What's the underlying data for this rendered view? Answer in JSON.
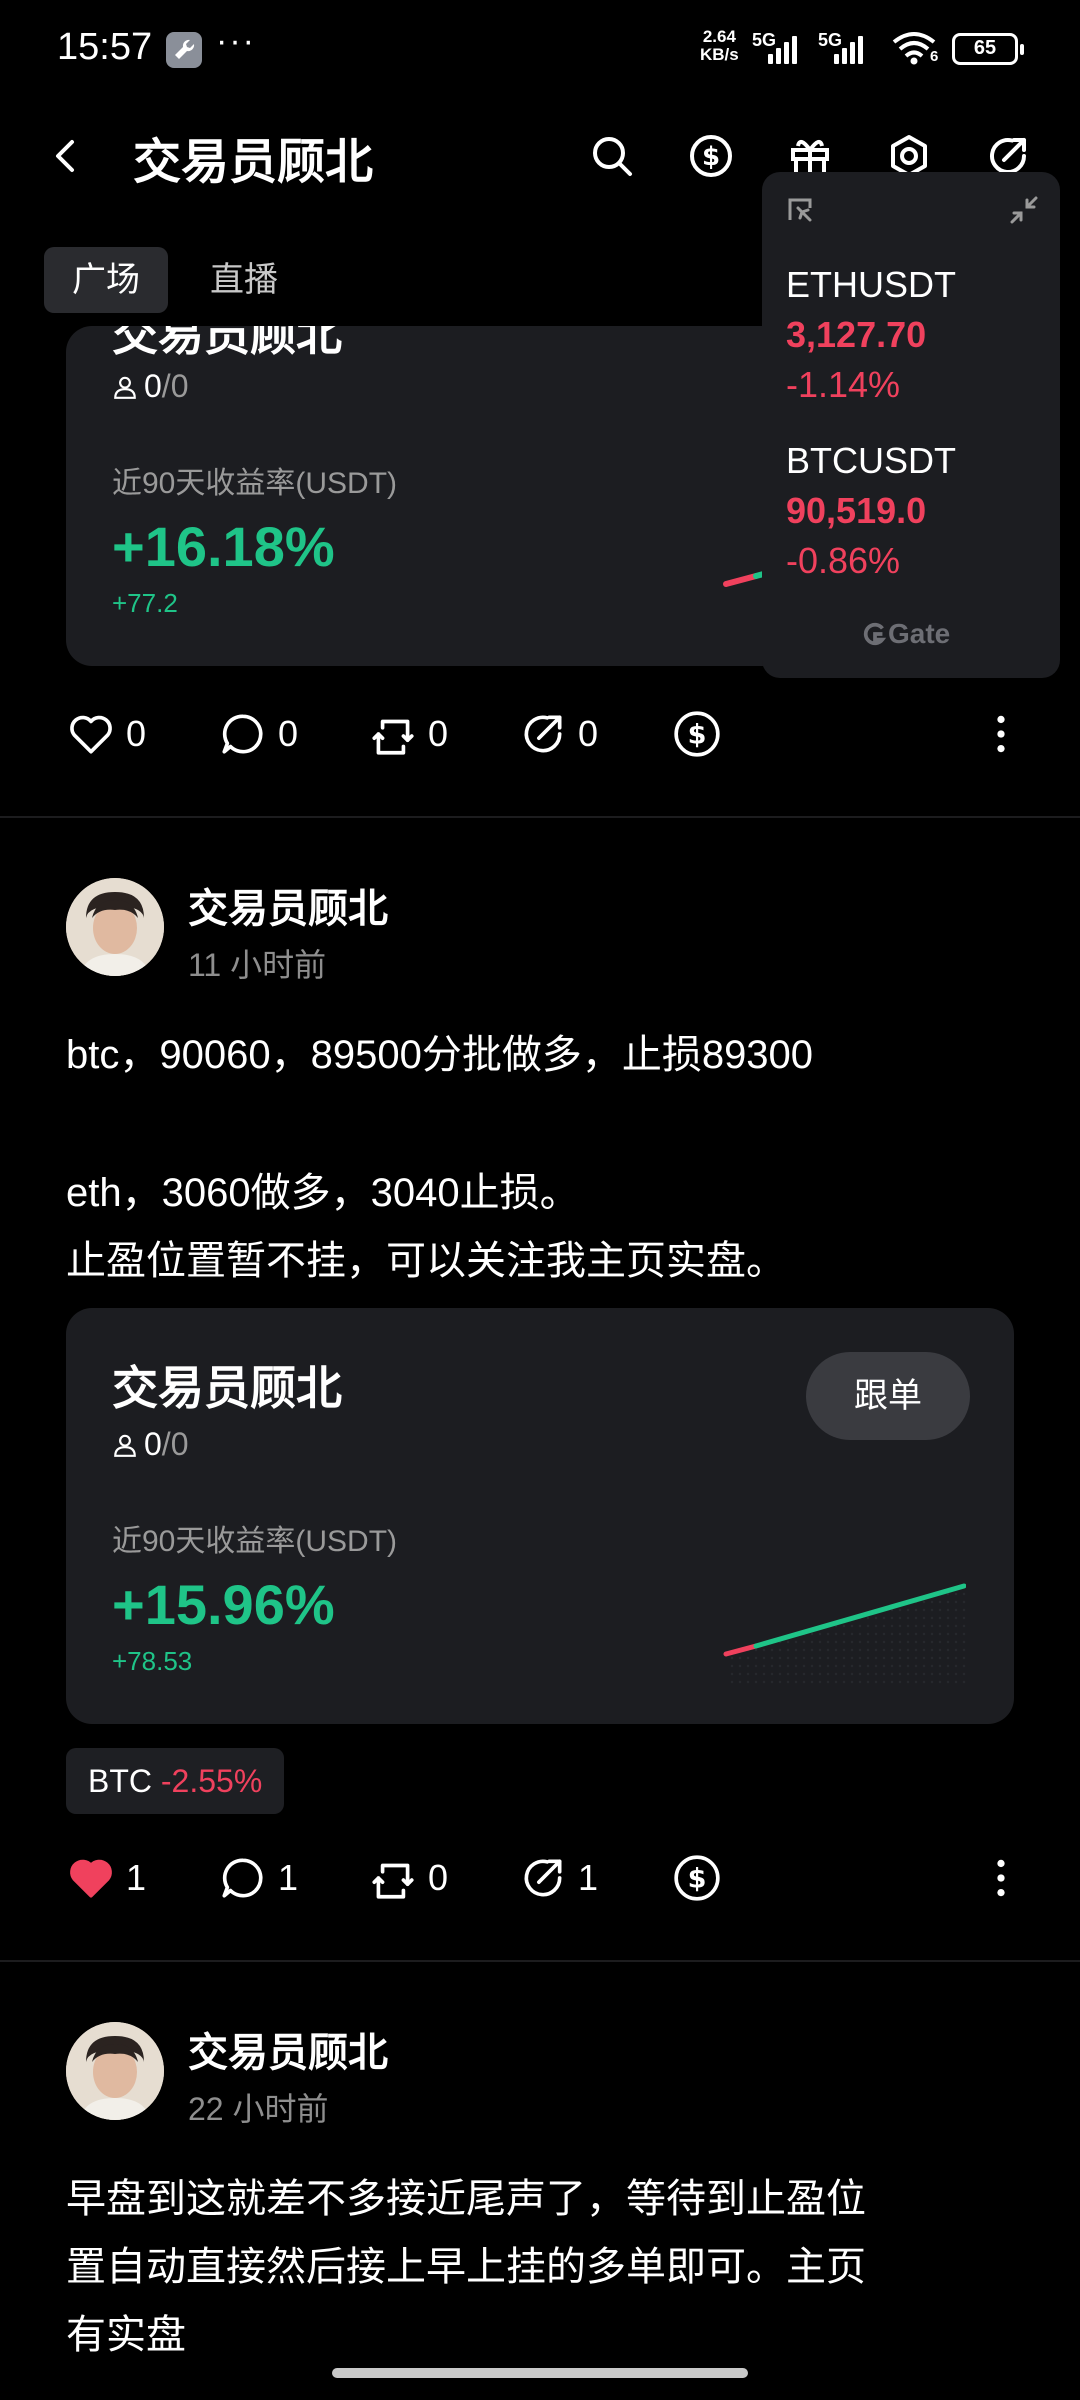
{
  "status_bar": {
    "time": "15:57",
    "speed_value": "2.64",
    "speed_unit": "KB/s",
    "net1": "5G",
    "net2": "5G",
    "wifi_badge": "6",
    "battery": "65"
  },
  "header": {
    "title": "交易员顾北",
    "icons": [
      "back-icon",
      "search-icon",
      "dollar-coin-icon",
      "gift-icon",
      "settings-icon",
      "share-icon"
    ]
  },
  "tabs": [
    {
      "label": "广场",
      "active": true
    },
    {
      "label": "直播",
      "active": false
    }
  ],
  "cards": [
    {
      "name": "交易员顾北",
      "followers": "0",
      "followers_max": "/0",
      "label": "近90天收益率(USDT)",
      "return_pct": "+16.18%",
      "return_abs": "+77.2"
    },
    {
      "name": "交易员顾北",
      "followers": "0",
      "followers_max": "/0",
      "label": "近90天收益率(USDT)",
      "return_pct": "+15.96%",
      "return_abs": "+78.53",
      "button": "跟单"
    }
  ],
  "action_rows": [
    {
      "like": "0",
      "comment": "0",
      "repost": "0",
      "share": "0",
      "liked": false
    },
    {
      "like": "1",
      "comment": "1",
      "repost": "0",
      "share": "1",
      "liked": true
    }
  ],
  "posts": [
    {
      "author": "交易员顾北",
      "time": "11 小时前",
      "lines": [
        "btc，90060，89500分批做多，止损89300",
        "eth，3060做多，3040止损。",
        "止盈位置暂不挂，可以关注我主页实盘。"
      ],
      "chip_symbol": "BTC",
      "chip_change": "-2.55%"
    },
    {
      "author": "交易员顾北",
      "time": "22 小时前",
      "lines": [
        "早盘到这就差不多接近尾声了，等待到止盈位",
        "置自动直接然后接上早上挂的多单即可。主页",
        "有实盘"
      ]
    }
  ],
  "ticker": {
    "items": [
      {
        "symbol": "ETHUSDT",
        "price": "3,127.70",
        "change": "-1.14%"
      },
      {
        "symbol": "BTCUSDT",
        "price": "90,519.0",
        "change": "-0.86%"
      }
    ],
    "brand": "Gate"
  },
  "colors": {
    "positive": "#1fc488",
    "negative": "#f0415d",
    "card_bg": "#1c1d21",
    "like_active": "#f0415d"
  }
}
